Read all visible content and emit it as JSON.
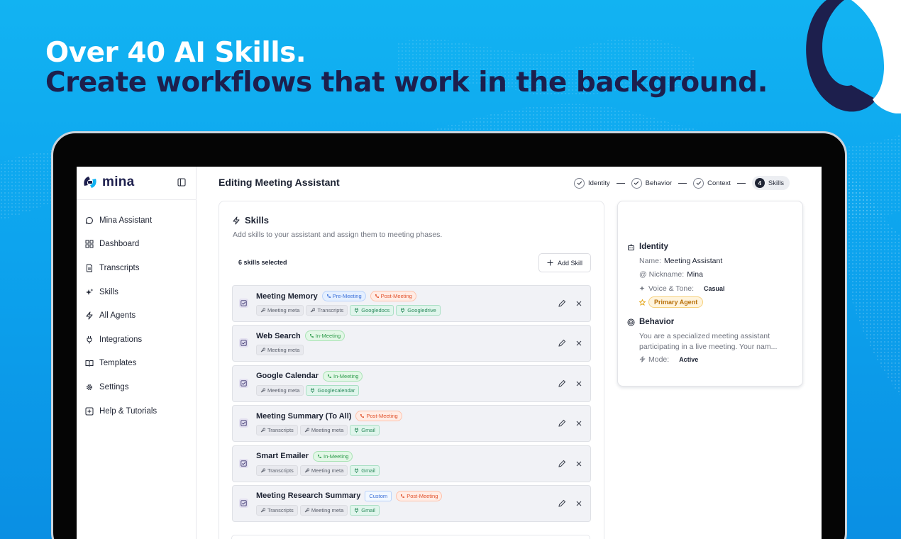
{
  "headline": {
    "line1": "Over 40 AI Skills.",
    "line2": "Create workflows that work in the background."
  },
  "colors": {
    "background": "#0da4ee",
    "headline_dark": "#1d1f4d",
    "brand_dark": "#1d1f4d",
    "brand_accent": "#12b3f2"
  },
  "app": {
    "brand": "mina",
    "nav": [
      {
        "label": "Mina Assistant",
        "icon": "chat-bubble-icon"
      },
      {
        "label": "Dashboard",
        "icon": "dashboard-grid-icon"
      },
      {
        "label": "Transcripts",
        "icon": "document-icon"
      },
      {
        "label": "Skills",
        "icon": "sparkles-icon"
      },
      {
        "label": "All Agents",
        "icon": "lightning-icon"
      },
      {
        "label": "Integrations",
        "icon": "plug-icon"
      },
      {
        "label": "Templates",
        "icon": "book-icon"
      },
      {
        "label": "Settings",
        "icon": "gear-icon"
      },
      {
        "label": "Help & Tutorials",
        "icon": "help-square-icon"
      }
    ]
  },
  "main": {
    "title": "Editing Meeting Assistant",
    "steps": [
      {
        "label": "Identity",
        "state": "done"
      },
      {
        "label": "Behavior",
        "state": "done"
      },
      {
        "label": "Context",
        "state": "done"
      },
      {
        "label": "Skills",
        "state": "active",
        "number": "4"
      }
    ],
    "skills": {
      "title": "Skills",
      "subtitle": "Add skills to your assistant and assign them to meeting phases.",
      "count_text": "6 skills selected",
      "add_label": "Add Skill",
      "items": [
        {
          "name": "Meeting Memory",
          "phases": [
            {
              "label": "Pre-Meeting",
              "kind": "blue"
            },
            {
              "label": "Post-Meeting",
              "kind": "orange"
            }
          ],
          "tags": [
            {
              "label": "Meeting meta",
              "kind": "meta"
            },
            {
              "label": "Transcripts",
              "kind": "meta"
            },
            {
              "label": "Googledocs",
              "kind": "tool"
            },
            {
              "label": "Googledrive",
              "kind": "tool"
            }
          ]
        },
        {
          "name": "Web Search",
          "phases": [
            {
              "label": "In-Meeting",
              "kind": "green"
            }
          ],
          "tags": [
            {
              "label": "Meeting meta",
              "kind": "meta"
            }
          ]
        },
        {
          "name": "Google Calendar",
          "phases": [
            {
              "label": "In-Meeting",
              "kind": "green"
            }
          ],
          "tags": [
            {
              "label": "Meeting meta",
              "kind": "meta"
            },
            {
              "label": "Googlecalendar",
              "kind": "tool"
            }
          ]
        },
        {
          "name": "Meeting Summary (To All)",
          "phases": [
            {
              "label": "Post-Meeting",
              "kind": "orange"
            }
          ],
          "tags": [
            {
              "label": "Transcripts",
              "kind": "meta"
            },
            {
              "label": "Meeting meta",
              "kind": "meta"
            },
            {
              "label": "Gmail",
              "kind": "tool"
            }
          ]
        },
        {
          "name": "Smart Emailer",
          "phases": [
            {
              "label": "In-Meeting",
              "kind": "green"
            }
          ],
          "tags": [
            {
              "label": "Transcripts",
              "kind": "meta"
            },
            {
              "label": "Meeting meta",
              "kind": "meta"
            },
            {
              "label": "Gmail",
              "kind": "tool"
            }
          ]
        },
        {
          "name": "Meeting Research Summary",
          "phases": [
            {
              "label": "Custom",
              "kind": "custom"
            },
            {
              "label": "Post-Meeting",
              "kind": "orange"
            }
          ],
          "tags": [
            {
              "label": "Transcripts",
              "kind": "meta"
            },
            {
              "label": "Meeting meta",
              "kind": "meta"
            },
            {
              "label": "Gmail",
              "kind": "tool"
            }
          ]
        }
      ]
    }
  },
  "summary": {
    "identity": {
      "title": "Identity",
      "name_label": "Name:",
      "name_value": "Meeting Assistant",
      "nickname_label": "@ Nickname:",
      "nickname_value": "Mina",
      "voice_label": "Voice & Tone:",
      "voice_value": "Casual",
      "primary_badge": "Primary Agent"
    },
    "behavior": {
      "title": "Behavior",
      "text_line1": "You are a specialized meeting assistant",
      "text_line2": "participating in a live meeting. Your nam...",
      "mode_label": "Mode:",
      "mode_value": "Active"
    }
  }
}
